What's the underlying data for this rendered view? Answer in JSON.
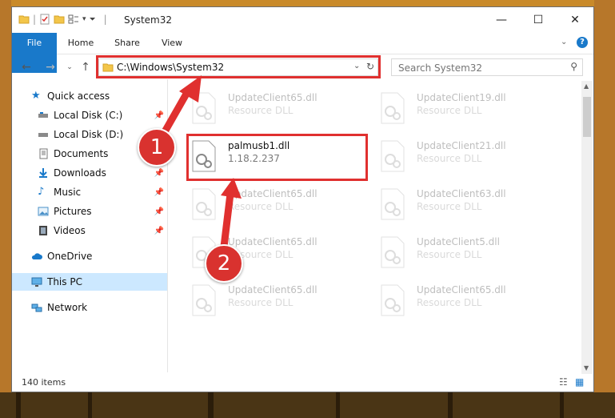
{
  "window": {
    "title": "System32"
  },
  "ribbon": {
    "tabs": [
      "File",
      "Home",
      "Share",
      "View"
    ]
  },
  "address": {
    "path": "C:\\Windows\\System32"
  },
  "search": {
    "placeholder": "Search System32"
  },
  "sidebar": {
    "items": [
      {
        "label": "Quick access",
        "icon": "star-icon",
        "pinned": false
      },
      {
        "label": "Local Disk (C:)",
        "icon": "drive-icon",
        "pinned": true
      },
      {
        "label": "Local Disk (D:)",
        "icon": "drive-icon",
        "pinned": false
      },
      {
        "label": "Documents",
        "icon": "documents-icon",
        "pinned": true
      },
      {
        "label": "Downloads",
        "icon": "download-icon",
        "pinned": true
      },
      {
        "label": "Music",
        "icon": "music-icon",
        "pinned": true
      },
      {
        "label": "Pictures",
        "icon": "pictures-icon",
        "pinned": true
      },
      {
        "label": "Videos",
        "icon": "videos-icon",
        "pinned": true
      },
      {
        "label": "OneDrive",
        "icon": "cloud-icon",
        "pinned": false
      },
      {
        "label": "This PC",
        "icon": "computer-icon",
        "pinned": false,
        "selected": true
      },
      {
        "label": "Network",
        "icon": "network-icon",
        "pinned": false
      }
    ]
  },
  "files": {
    "col1": [
      {
        "name": "UpdateClient65.dll",
        "type": "Resource DLL"
      },
      {
        "name": "palmusb1.dll",
        "type": "1.18.2.237"
      },
      {
        "name": "UpdateClient65.dll",
        "type": "Resource DLL"
      },
      {
        "name": "UpdateClient65.dll",
        "type": "Resource DLL"
      },
      {
        "name": "UpdateClient65.dll",
        "type": "Resource DLL"
      }
    ],
    "col2": [
      {
        "name": "UpdateClient19.dll",
        "type": "Resource DLL"
      },
      {
        "name": "UpdateClient21.dll",
        "type": "Resource DLL"
      },
      {
        "name": "UpdateClient63.dll",
        "type": "Resource DLL"
      },
      {
        "name": "UpdateClient5.dll",
        "type": "Resource DLL"
      },
      {
        "name": "UpdateClient65.dll",
        "type": "Resource DLL"
      }
    ]
  },
  "status": {
    "count": "140 items"
  },
  "callouts": {
    "one": "1",
    "two": "2"
  },
  "colors": {
    "accent": "#1979ca",
    "callout": "#e0302f",
    "selected": "#cce8ff"
  }
}
